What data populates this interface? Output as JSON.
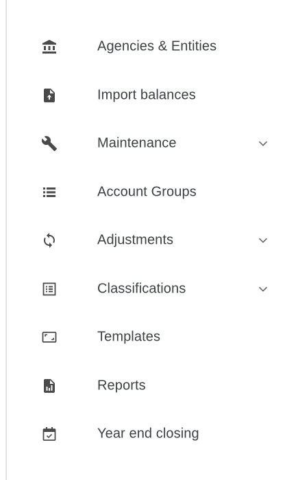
{
  "sidebar": {
    "items": [
      {
        "label": "Agencies & Entities",
        "icon": "bank-icon",
        "expandable": false
      },
      {
        "label": "Import balances",
        "icon": "file-upload-icon",
        "expandable": false
      },
      {
        "label": "Maintenance",
        "icon": "wrench-icon",
        "expandable": true
      },
      {
        "label": "Account Groups",
        "icon": "list-icon",
        "expandable": false
      },
      {
        "label": "Adjustments",
        "icon": "sync-icon",
        "expandable": true
      },
      {
        "label": "Classifications",
        "icon": "list-box-icon",
        "expandable": true
      },
      {
        "label": "Templates",
        "icon": "aspect-ratio-icon",
        "expandable": false
      },
      {
        "label": "Reports",
        "icon": "file-chart-icon",
        "expandable": false
      },
      {
        "label": "Year end closing",
        "icon": "calendar-check-icon",
        "expandable": false
      }
    ]
  },
  "colors": {
    "text": "#3c4043",
    "icon": "#4a4a4a",
    "chevron": "#6b6b6b",
    "border": "#e2e2e2",
    "background": "#ffffff"
  }
}
